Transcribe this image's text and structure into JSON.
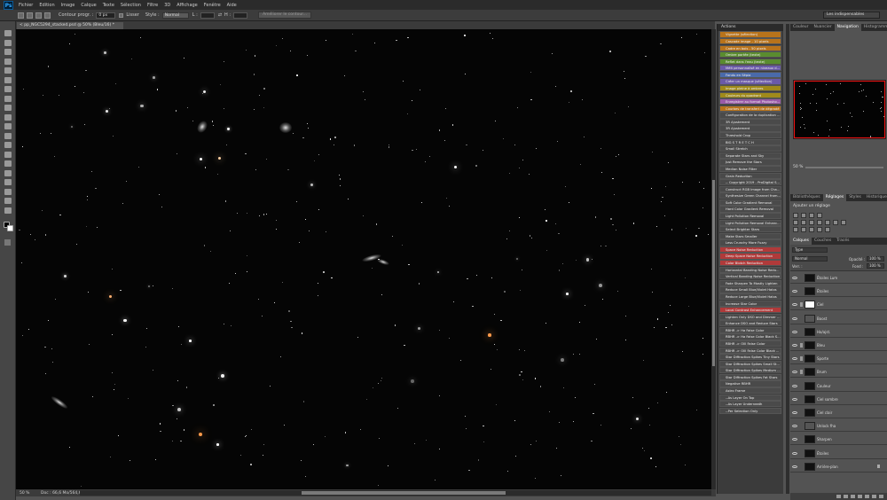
{
  "menubar": {
    "logo": "Ps",
    "items": [
      "Fichier",
      "Edition",
      "Image",
      "Calque",
      "Texte",
      "Sélection",
      "Filtre",
      "3D",
      "Affichage",
      "Fenêtre",
      "Aide"
    ]
  },
  "options": {
    "contour_label": "Contour progr. :",
    "contour_value": "0 px",
    "lisser_label": "Lisser",
    "style_label": "Style :",
    "style_value": "Normal",
    "l_label": "L :",
    "h_label": "H :",
    "refine_button": "Améliorer le contour...",
    "workspace": "Les indispensables"
  },
  "document": {
    "tab": "< pp_NGC5294_stacked.psd @ 50% (Bleu/16) *",
    "zoom": "50 %",
    "doc_size": "Doc : 66,6 Mo/564,6 Mo"
  },
  "actions": {
    "title": "Actions",
    "items": [
      {
        "label": "Vignette (sélection)",
        "color": "#b8731b"
      },
      {
        "label": "Cascade image - 10 pixels",
        "color": "#b8731b"
      },
      {
        "label": "Cadre en bois - 50 pixels",
        "color": "#b8731b"
      },
      {
        "label": "Ombre portée (texte)",
        "color": "#5a8c2f"
      },
      {
        "label": "Reflet dans l'eau (texte)",
        "color": "#5a8c2f"
      },
      {
        "label": "Mélt personnalisé en niveaux d...",
        "color": "#6a5aa8"
      },
      {
        "label": "Fondu en Sépia",
        "color": "#4a6aaa"
      },
      {
        "label": "Créer un masque (sélection)",
        "color": "#6a5aa8"
      },
      {
        "label": "Image pleine à ombres",
        "color": "#a08a1a"
      },
      {
        "label": "Couleurs du quadrant",
        "color": "#a08a1a"
      },
      {
        "label": "Enregistrer au format Photosho...",
        "color": "#9a5aa8"
      },
      {
        "label": "Courbes de transfert de dégradé",
        "color": "#b8731b"
      },
      {
        "label": "Configuration de la duplication ...",
        "color": "#4a4a4a"
      },
      {
        "label": "3R Ajustement",
        "color": "#4a4a4a"
      },
      {
        "label": "3R Ajustement",
        "color": "#4a4a4a"
      },
      {
        "label": "Threshold Crop",
        "color": "#4a4a4a"
      },
      {
        "label": "BIG S T R E T C H",
        "color": "#4a4a4a"
      },
      {
        "label": "Small Stretch",
        "color": "#4a4a4a"
      },
      {
        "label": "Separate Stars and Sky",
        "color": "#4a4a4a"
      },
      {
        "label": "Just Remove the Stars",
        "color": "#4a4a4a"
      },
      {
        "label": "Median Noise Filter",
        "color": "#4a4a4a"
      },
      {
        "label": "Grain Reduction",
        "color": "#4a4a4a"
      },
      {
        "label": "-- Copyright 2019 - ProDigital S...",
        "color": "#4a4a4a"
      },
      {
        "label": "Construct RGB Image from Cha...",
        "color": "#4a4a4a"
      },
      {
        "label": "Synthesize Green Channel from...",
        "color": "#4a4a4a"
      },
      {
        "label": "Soft Color Gradient Removal",
        "color": "#4a4a4a"
      },
      {
        "label": "Hard Color Gradient Removal",
        "color": "#4a4a4a"
      },
      {
        "label": "Light Pollution Removal",
        "color": "#4a4a4a"
      },
      {
        "label": "Light Pollution Removal Enhanc...",
        "color": "#4a4a4a"
      },
      {
        "label": "Select Brighter Stars",
        "color": "#4a4a4a"
      },
      {
        "label": "Make Stars Smaller",
        "color": "#4a4a4a"
      },
      {
        "label": "Less Crunchy More Fuzzy",
        "color": "#4a4a4a"
      },
      {
        "label": "Space Noise Reduction",
        "color": "#b03a3a"
      },
      {
        "label": "Deep Space Noise Reduction",
        "color": "#b03a3a"
      },
      {
        "label": "Color Blotch Reduction",
        "color": "#b03a3a"
      },
      {
        "label": "Horizontal Banding Noise Redu...",
        "color": "#4a4a4a"
      },
      {
        "label": "Vertical Banding Noise Reduction",
        "color": "#4a4a4a"
      },
      {
        "label": "Fade Sharpen To Mostly Lighten",
        "color": "#4a4a4a"
      },
      {
        "label": "Reduce Small Blue/Violet Halos",
        "color": "#4a4a4a"
      },
      {
        "label": "Reduce Large Blue/Violet Halos",
        "color": "#4a4a4a"
      },
      {
        "label": "Increase Star Color",
        "color": "#4a4a4a"
      },
      {
        "label": "Local Contrast Enhancement",
        "color": "#b03a3a"
      },
      {
        "label": "Lighten Only DSO and Dimmer ...",
        "color": "#4a4a4a"
      },
      {
        "label": "Enhance DSO and Reduce Stars",
        "color": "#4a4a4a"
      },
      {
        "label": "RBHR -> Ha False Color",
        "color": "#4a4a4a"
      },
      {
        "label": "RBHR -> Ha False Color Black S...",
        "color": "#4a4a4a"
      },
      {
        "label": "RBHR -> OIII False Color",
        "color": "#4a4a4a"
      },
      {
        "label": "RBHR -> OIII False Color Black ...",
        "color": "#4a4a4a"
      },
      {
        "label": "Star Diffraction Spikes Tiny Stars",
        "color": "#4a4a4a"
      },
      {
        "label": "Star Diffraction Spikes Small St...",
        "color": "#4a4a4a"
      },
      {
        "label": "Star Diffraction Spikes Medium ...",
        "color": "#4a4a4a"
      },
      {
        "label": "Star Diffraction Spikes Fat Stars",
        "color": "#4a4a4a"
      },
      {
        "label": "Negative RBHR",
        "color": "#4a4a4a"
      },
      {
        "label": "Astro Frame",
        "color": "#4a4a4a"
      },
      {
        "label": "--As Layer On Top",
        "color": "#4a4a4a"
      },
      {
        "label": "--As Layer Underneath",
        "color": "#4a4a4a"
      },
      {
        "label": "--Per Selection Only",
        "color": "#4a4a4a"
      }
    ]
  },
  "navigator": {
    "tabs": [
      "Couleur",
      "Nuancier",
      "Navigation",
      "Histogramme"
    ],
    "active": "Navigation",
    "zoom": "50 %"
  },
  "adjustments": {
    "tabs": [
      "Bibliothèques",
      "Réglages",
      "Styles",
      "Historique"
    ],
    "active": "Réglages",
    "title": "Ajouter un réglage"
  },
  "layers": {
    "tabs": [
      "Calques",
      "Couches",
      "Tracés"
    ],
    "active": "Calques",
    "kind_filter": "Type",
    "blend_mode": "Normal",
    "opacity_label": "Opacité :",
    "opacity_value": "100 %",
    "lock_label": "Verr. :",
    "fill_label": "Fond :",
    "fill_value": "100 %",
    "items": [
      {
        "name": "Étoiles Lum",
        "thumb": "black",
        "chain": false
      },
      {
        "name": "Étoiles",
        "thumb": "black",
        "chain": false
      },
      {
        "name": "Ciel",
        "thumb": "white",
        "chain": true
      },
      {
        "name": "Boost",
        "thumb": "grey",
        "chain": false
      },
      {
        "name": "Ha/ajst.",
        "thumb": "black",
        "chain": false
      },
      {
        "name": "Bleu",
        "thumb": "black",
        "chain": true
      },
      {
        "name": "Sporte",
        "thumb": "black",
        "chain": true
      },
      {
        "name": "Brum",
        "thumb": "black",
        "chain": true
      },
      {
        "name": "Couleur",
        "thumb": "black",
        "chain": false
      },
      {
        "name": "Ciel sombre",
        "thumb": "black",
        "chain": false
      },
      {
        "name": "Ciel clair",
        "thumb": "black",
        "chain": false
      },
      {
        "name": "Unlock fha",
        "thumb": "grey",
        "chain": false
      },
      {
        "name": "Sharpen",
        "thumb": "black",
        "chain": false
      },
      {
        "name": "Étoiles",
        "thumb": "black",
        "chain": false
      },
      {
        "name": "Arrière-plan",
        "thumb": "black",
        "chain": false
      }
    ]
  }
}
